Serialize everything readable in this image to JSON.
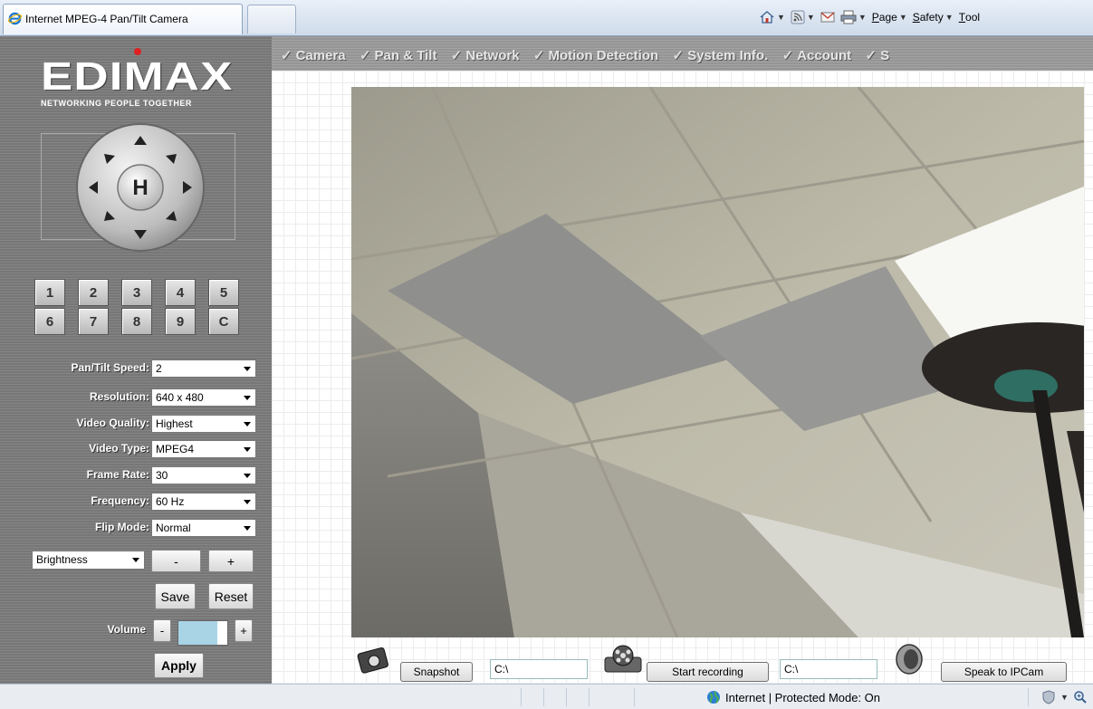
{
  "browser": {
    "tab_title": "Internet MPEG-4 Pan/Tilt Camera",
    "menus": [
      {
        "label": "Page",
        "underline": "P",
        "rest": "age"
      },
      {
        "label": "Safety",
        "underline": "S",
        "rest": "afety"
      },
      {
        "label": "Tools",
        "underline": "T",
        "rest": "ool"
      }
    ]
  },
  "logo": {
    "brand": "EDIMAX",
    "tagline": "NETWORKING PEOPLE TOGETHER"
  },
  "ptz": {
    "home_label": "H"
  },
  "presets": [
    "1",
    "2",
    "3",
    "4",
    "5",
    "6",
    "7",
    "8",
    "9",
    "C"
  ],
  "settings": [
    {
      "label": "Pan/Tilt Speed:",
      "value": "2"
    },
    {
      "label": "Resolution:",
      "value": "640 x 480"
    },
    {
      "label": "Video Quality:",
      "value": "Highest"
    },
    {
      "label": "Video Type:",
      "value": "MPEG4"
    },
    {
      "label": "Frame Rate:",
      "value": "30"
    },
    {
      "label": "Frequency:",
      "value": "60 Hz"
    },
    {
      "label": "Flip Mode:",
      "value": "Normal"
    }
  ],
  "adjust": {
    "selected": "Brightness",
    "minus": "-",
    "plus": "+"
  },
  "buttons": {
    "save": "Save",
    "reset": "Reset",
    "apply": "Apply"
  },
  "volume": {
    "label": "Volume",
    "minus": "-",
    "plus": "+"
  },
  "menu": [
    "Camera",
    "Pan & Tilt",
    "Network",
    "Motion Detection",
    "System Info.",
    "Account",
    "S"
  ],
  "controls": {
    "snapshot": "Snapshot",
    "snapshot_path": "C:\\",
    "record": "Start recording",
    "record_path": "C:\\",
    "speak": "Speak to IPCam"
  },
  "status": {
    "zone": "Internet | Protected Mode: On"
  }
}
